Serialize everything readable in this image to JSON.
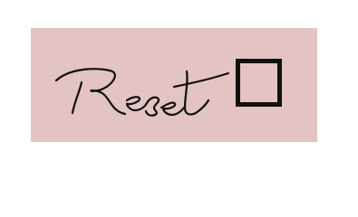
{
  "button": {
    "label": "Reset",
    "background_color": "#e3c3c3",
    "text_color": "#111111",
    "icon": "checkbox-square-icon",
    "checked": false
  }
}
